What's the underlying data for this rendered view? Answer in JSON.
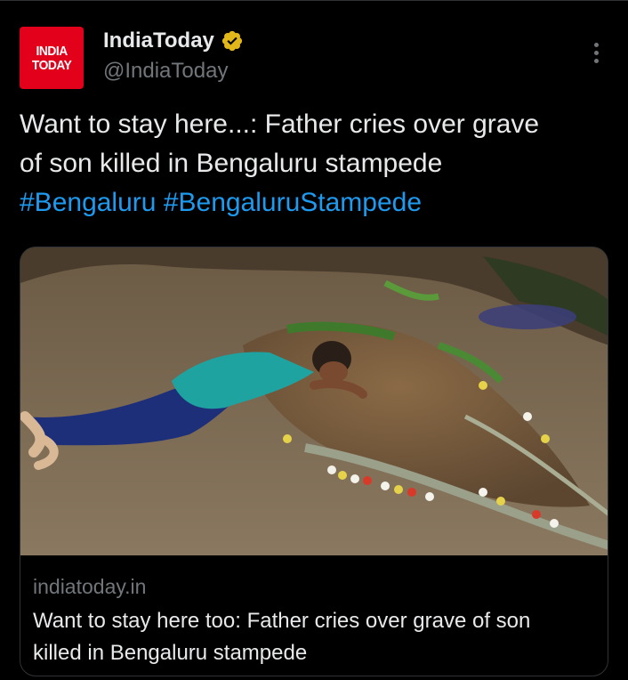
{
  "account": {
    "logo_line1": "INDIA",
    "logo_line2": "TODAY",
    "display_name": "IndiaToday",
    "handle": "@IndiaToday",
    "verified": true
  },
  "tweet": {
    "text_line1": "Want to stay here...: Father cries over grave",
    "text_line2": "of son killed in Bengaluru stampede",
    "hashtags": [
      "#Bengaluru",
      "#BengaluruStampede"
    ]
  },
  "link_card": {
    "domain": "indiatoday.in",
    "title_line1": "Want to stay here too: Father cries over grave of son",
    "title_line2": "killed in Bengaluru stampede"
  },
  "colors": {
    "background": "#000000",
    "text": "#e7e9ea",
    "muted": "#71767b",
    "link": "#1d9bf0",
    "brand": "#e2001a",
    "verified_badge": "#e2b719"
  },
  "icons": {
    "verified": "gold-verified-badge-icon",
    "more": "more-options-icon"
  }
}
